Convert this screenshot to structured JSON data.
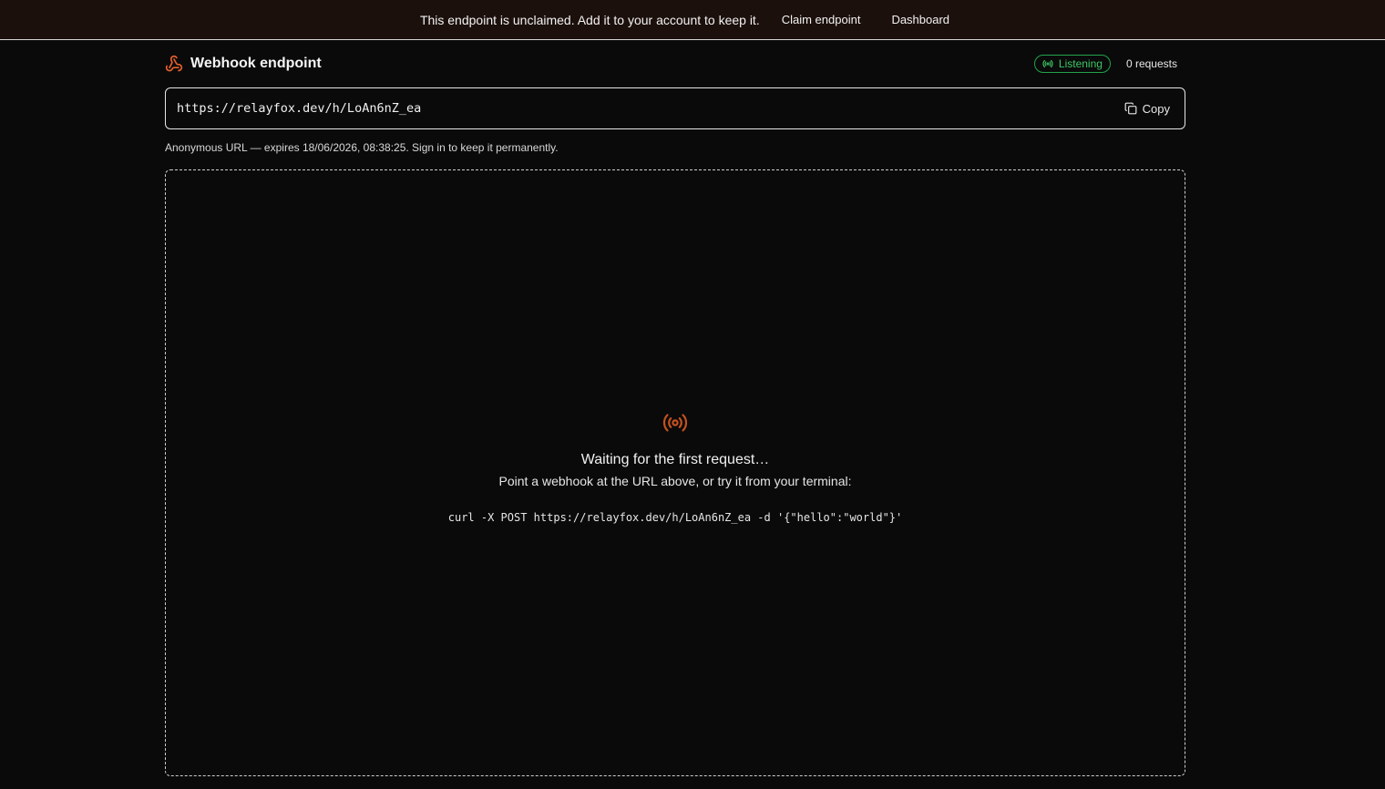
{
  "banner": {
    "message": "This endpoint is unclaimed. Add it to your account to keep it.",
    "claim_label": "Claim endpoint",
    "dashboard_label": "Dashboard"
  },
  "header": {
    "title": "Webhook endpoint",
    "status": "Listening",
    "requests": "0 requests"
  },
  "endpoint": {
    "url": "https://relayfox.dev/h/LoAn6nZ_ea",
    "copy_label": "Copy",
    "note": "Anonymous URL — expires 18/06/2026, 08:38:25. Sign in to keep it permanently."
  },
  "empty_state": {
    "title": "Waiting for the first request…",
    "subtitle": "Point a webhook at the URL above, or try it from your terminal:",
    "command": "curl -X POST https://relayfox.dev/h/LoAn6nZ_ea -d '{\"hello\":\"world\"}'"
  },
  "icons": {
    "brand": "webhook-icon",
    "status": "radio-icon",
    "copy": "copy-icon",
    "empty": "broadcast-icon"
  },
  "colors": {
    "accent": "#e8612c",
    "listening": "#22a34a",
    "background": "#0a0a0a",
    "banner_bg": "#1b100c"
  }
}
